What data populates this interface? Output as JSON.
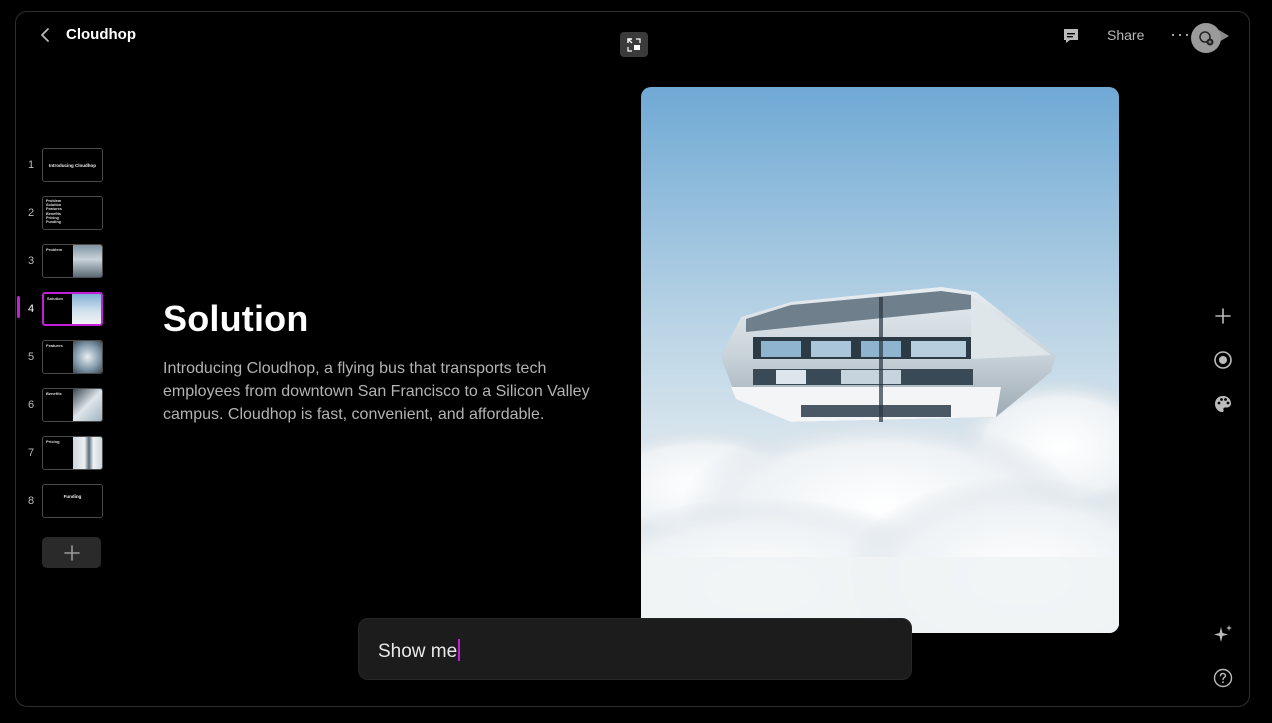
{
  "header": {
    "title": "Cloudhop",
    "share_label": "Share",
    "more_label": "···"
  },
  "slides": [
    {
      "num": "1",
      "kind": "title",
      "text": "Introducing Cloudhop"
    },
    {
      "num": "2",
      "kind": "list",
      "lines": [
        "Problem",
        "Solution",
        "Features",
        "Benefits",
        "Pricing",
        "Funding"
      ]
    },
    {
      "num": "3",
      "kind": "image",
      "text": "Problem"
    },
    {
      "num": "4",
      "kind": "image",
      "text": "Solution",
      "active": true
    },
    {
      "num": "5",
      "kind": "image",
      "text": "Features"
    },
    {
      "num": "6",
      "kind": "image",
      "text": "Benefits"
    },
    {
      "num": "7",
      "kind": "image",
      "text": "Pricing"
    },
    {
      "num": "8",
      "kind": "title",
      "text": "Funding"
    }
  ],
  "current_slide": {
    "title": "Solution",
    "body": "Introducing Cloudhop, a flying bus that transports tech employees from downtown San Francisco to a Silicon Valley campus. Cloudhop is fast, convenient, and affordable."
  },
  "prompt": {
    "value": "Show me"
  },
  "colors": {
    "accent": "#c21fd6",
    "background": "#000000",
    "panel": "#1c1c1c"
  },
  "icons": {
    "back": "chevron-left-icon",
    "center": "minimize-icon",
    "comment": "comment-icon",
    "play": "play-icon",
    "avatar": "avatar-icon",
    "add": "plus-icon",
    "record": "record-icon",
    "theme": "palette-icon",
    "ai": "sparkle-icon",
    "help": "help-icon"
  }
}
